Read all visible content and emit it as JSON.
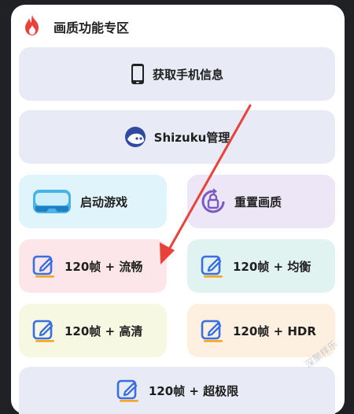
{
  "section": {
    "title": "画质功能专区"
  },
  "buttons": {
    "device_info": "获取手机信息",
    "shizuku": "Shizuku管理",
    "start_game": "启动游戏",
    "reset_quality": "重置画质",
    "fps120_smooth": "120帧 + 流畅",
    "fps120_balanced": "120帧 + 均衡",
    "fps120_hd": "120帧 + 高清",
    "fps120_hdr": "120帧 + HDR",
    "fps120_extreme": "120帧 + 超极限"
  },
  "watermark": "深聚样乐",
  "icons": {
    "flame": "flame-icon",
    "phone": "phone-icon",
    "shizuku": "shizuku-avatar-icon",
    "vr": "vr-headset-icon",
    "reset": "lock-refresh-icon",
    "edit": "edit-icon"
  },
  "colors": {
    "accent_red": "#e8433a",
    "edit_blue": "#3b6fe0",
    "edit_orange": "#f5a623",
    "full_bg": "#e8eaf6",
    "start_bg": "#e0f4fb",
    "reset_bg": "#ece6f6",
    "smooth_bg": "#fde6ea",
    "balanced_bg": "#e1f3f1",
    "hd_bg": "#f7f8e2",
    "hdr_bg": "#fdf0e0"
  }
}
